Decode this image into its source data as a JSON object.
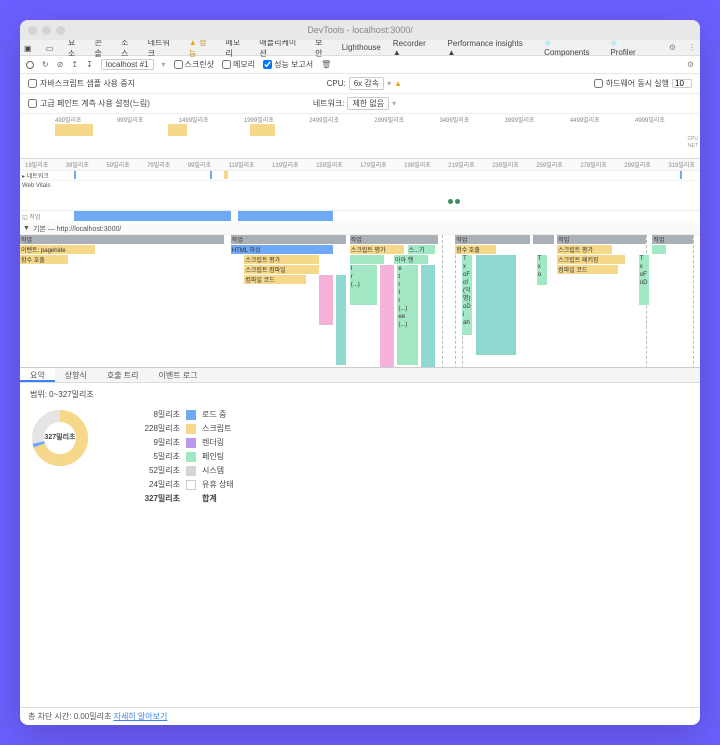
{
  "window": {
    "title": "DevTools - localhost:3000/"
  },
  "tabs": {
    "items": [
      "요소",
      "콘솔",
      "소스",
      "네트워크",
      "성능",
      "메모리",
      "애플리케이션",
      "보안",
      "Lighthouse",
      "Recorder ▲",
      "Performance insights ▲"
    ],
    "active_index": 4,
    "ext": [
      {
        "label": "Components",
        "icon": "react-icon"
      },
      {
        "label": "Profiler",
        "icon": "profiler-icon"
      }
    ]
  },
  "toolbar": {
    "select_value": "localhost #1",
    "screenshot": "스크린샷",
    "memory": "메모리",
    "perf_report": "성능 보고서",
    "perf_report_checked": true
  },
  "options": {
    "disable_js": "자바스크립트 샘플 사용 중지",
    "advanced_paint": "고급 페인트 계측 사용 설정(느림)",
    "cpu_label": "CPU:",
    "cpu_value": "6x 감속",
    "net_label": "네트워크:",
    "net_value": "제한 없음",
    "hw_label": "하드웨어 동시 실행",
    "hw_value": "10"
  },
  "overview": {
    "ticks": [
      "499밀리초",
      "999밀리초",
      "1499밀리초",
      "1999밀리초",
      "2499밀리초",
      "2999밀리초",
      "3499밀리초",
      "3999밀리초",
      "4499밀리초",
      "4999밀리초"
    ],
    "right_labels": [
      "CPU",
      "NET"
    ]
  },
  "main_ticks": [
    "19밀리초",
    "39밀리초",
    "59밀리초",
    "79밀리초",
    "99밀리초",
    "119밀리초",
    "139밀리초",
    "159밀리초",
    "179밀리초",
    "199밀리초",
    "219밀리초",
    "239밀리초",
    "259밀리초",
    "279밀리초",
    "299밀리초",
    "319밀리초"
  ],
  "tracks": {
    "network": "네트워크",
    "web_vitals": "Web Vitals",
    "main_label": "기본 — http://localhost:3000/",
    "task_cols": "작업"
  },
  "flame": {
    "event_pagehide": "이벤트: pagehide",
    "func_call": "함수 호출",
    "html_parse": "HTML 파싱",
    "script_eval": "스크립트 평가",
    "script_compile": "스크립트 컴파일",
    "compile_code": "컴파일 코드",
    "sq": "스...기",
    "aa": "아아 행",
    "ir": "I\nr\n(...)",
    "etr": "e\nt\nr\nI\nr\n(...)\nee\n(...)",
    "txof_ob": "T\nx\noF\nof\n(익명)\noD\ni\nah",
    "t1": "T\nx\no",
    "script_package": "스크립트 패키징",
    "t2": "T\nx\noF\noD"
  },
  "summary_tabs": [
    "요약",
    "상향식",
    "호출 트리",
    "이벤트 로그"
  ],
  "summary": {
    "range_label": "범위: 0~327밀리초",
    "donut_center": "327밀리초",
    "legend": [
      {
        "num": "8밀리초",
        "label": "로드 중",
        "sw": "sw-blue"
      },
      {
        "num": "228밀리초",
        "label": "스크립트",
        "sw": "sw-yellow"
      },
      {
        "num": "9밀리초",
        "label": "렌더링",
        "sw": "sw-purple"
      },
      {
        "num": "5밀리초",
        "label": "페인팅",
        "sw": "sw-green"
      },
      {
        "num": "52밀리초",
        "label": "시스템",
        "sw": "sw-grey"
      },
      {
        "num": "24밀리초",
        "label": "유휴 상태",
        "sw": "sw-white"
      },
      {
        "num": "327밀리초",
        "label": "합계",
        "sw": ""
      }
    ]
  },
  "footer": {
    "text": "총 차단 시간: 0.00밀리초 ",
    "link": "자세히 알아보기"
  }
}
